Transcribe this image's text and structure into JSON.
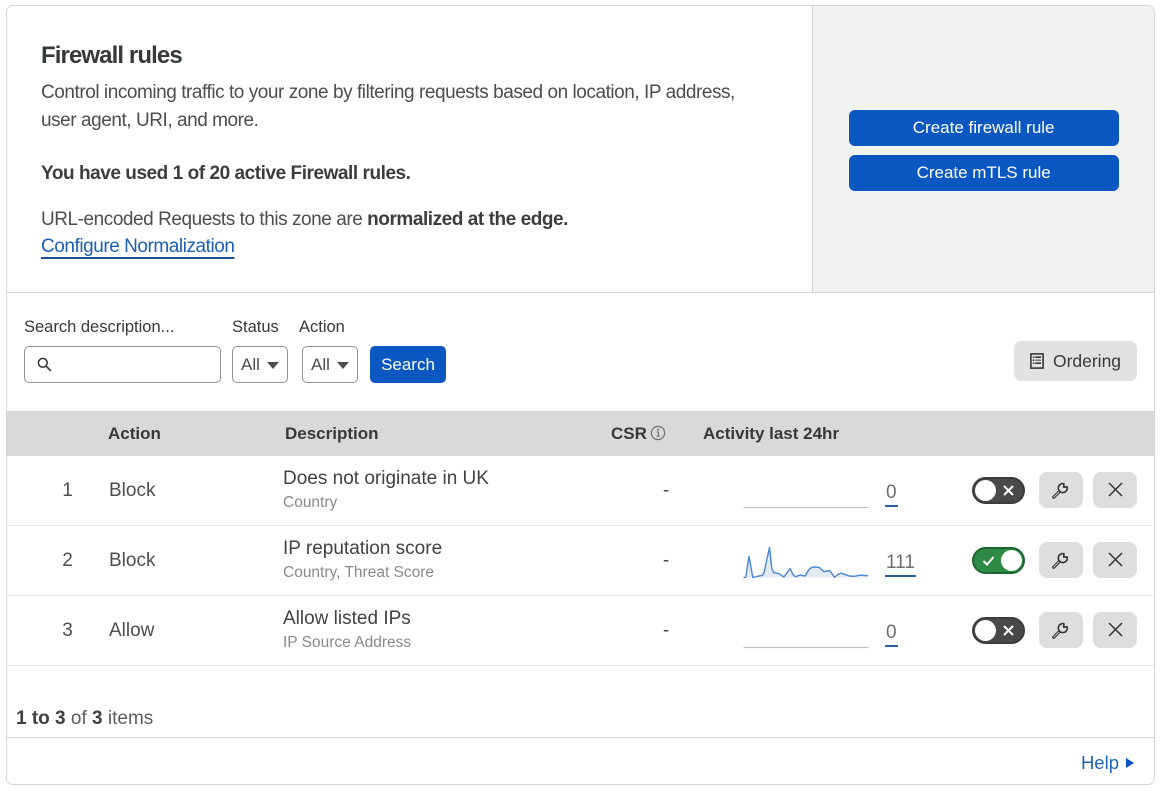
{
  "header": {
    "title": "Firewall rules",
    "description": "Control incoming traffic to your zone by filtering requests based on location, IP address, user agent, URI, and more.",
    "usage_note": "You have used 1 of 20 active Firewall rules.",
    "normalization_prefix": "URL-encoded Requests to this zone are ",
    "normalization_bold": "normalized at the edge.",
    "normalization_link": "Configure Normalization",
    "create_firewall_button": "Create firewall rule",
    "create_mtls_button": "Create mTLS rule"
  },
  "filters": {
    "search_label": "Search description...",
    "search_value": "",
    "status_label": "Status",
    "status_value": "All",
    "action_label": "Action",
    "action_value": "All",
    "search_button": "Search",
    "ordering_button": "Ordering"
  },
  "table": {
    "headers": {
      "action": "Action",
      "description": "Description",
      "csr": "CSR",
      "activity": "Activity last 24hr"
    },
    "rows": [
      {
        "priority": "1",
        "action": "Block",
        "description": "Does not originate in UK",
        "criteria": "Country",
        "csr": "-",
        "activity_count": "0",
        "enabled": false,
        "sparkline": []
      },
      {
        "priority": "2",
        "action": "Block",
        "description": "IP reputation score",
        "criteria": "Country, Threat Score",
        "csr": "-",
        "activity_count": "111",
        "enabled": true,
        "sparkline": [
          [
            0,
            0
          ],
          [
            2.2,
            0.2
          ],
          [
            5.5,
            21
          ],
          [
            9.3,
            0
          ],
          [
            14,
            1.2
          ],
          [
            19,
            2.2
          ],
          [
            20.5,
            5
          ],
          [
            26,
            30
          ],
          [
            28.3,
            9
          ],
          [
            30.3,
            4.8
          ],
          [
            35.5,
            3.8
          ],
          [
            40.4,
            0.5
          ],
          [
            44,
            5.5
          ],
          [
            46.6,
            9
          ],
          [
            49.8,
            2.5
          ],
          [
            51.9,
            0.8
          ],
          [
            56.8,
            2.4
          ],
          [
            61.7,
            1.4
          ],
          [
            65,
            7.5
          ],
          [
            68.5,
            10.3
          ],
          [
            72,
            10.6
          ],
          [
            75.8,
            10
          ],
          [
            80.5,
            5.8
          ],
          [
            86.2,
            6.8
          ],
          [
            91.1,
            0.3
          ],
          [
            95,
            3.5
          ],
          [
            97.7,
            4.4
          ],
          [
            101,
            3.2
          ],
          [
            105.9,
            1.5
          ],
          [
            110.8,
            1.2
          ],
          [
            117.3,
            2.4
          ],
          [
            121,
            2
          ],
          [
            124.7,
            1.8
          ]
        ]
      },
      {
        "priority": "3",
        "action": "Allow",
        "description": "Allow listed IPs",
        "criteria": "IP Source Address",
        "csr": "-",
        "activity_count": "0",
        "enabled": false,
        "sparkline": []
      }
    ]
  },
  "footer": {
    "range": "1 to 3",
    "of_word": "of",
    "total": "3",
    "items_word": "items",
    "help_label": "Help"
  },
  "colors": {
    "accent_blue": "#0b57c2",
    "link_blue": "#0051c3",
    "toggle_on_green": "#2c8a44",
    "toggle_off_gray": "#47494b",
    "header_band": "#d9d9d9",
    "panel_gray": "#f2f2f1",
    "sparkline_blue": "#4a86d4"
  },
  "icons": {
    "search": "magnifier",
    "status_caret": "▼",
    "action_caret": "▼",
    "ordering": "list-box",
    "csr_info": "ⓘ",
    "toggle_on": "check",
    "toggle_off": "x",
    "wrench": "wrench",
    "delete": "✕",
    "help_arrow": "▶"
  }
}
